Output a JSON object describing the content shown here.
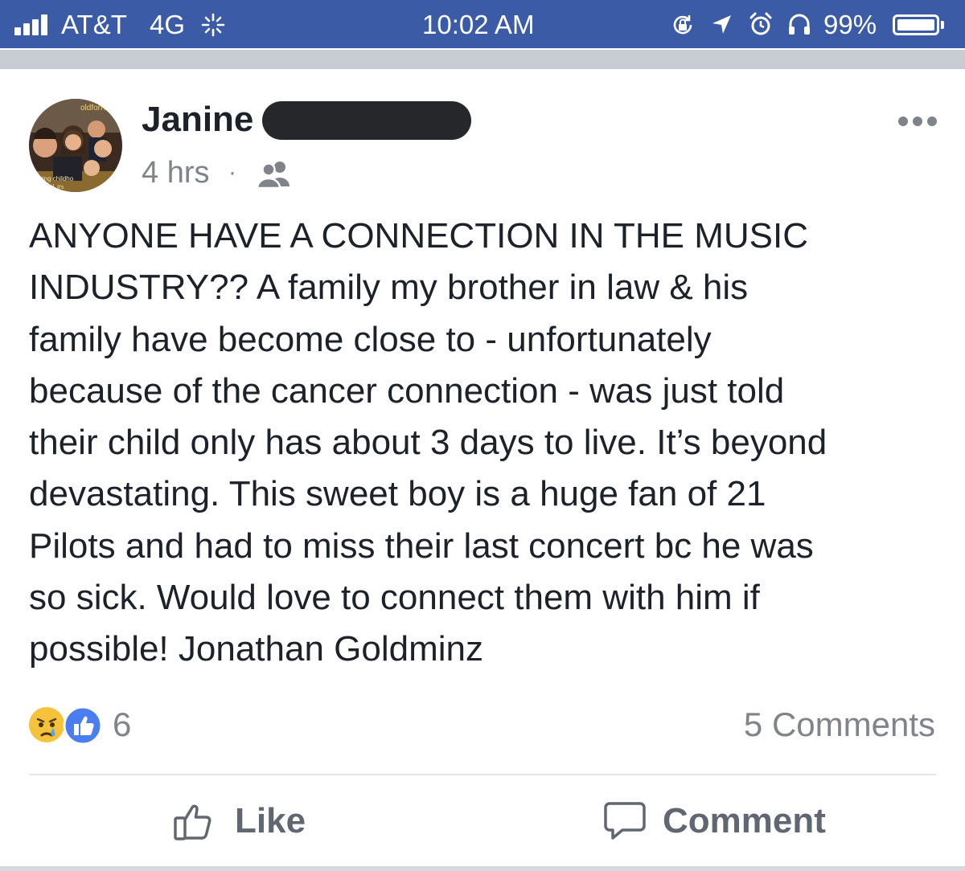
{
  "status_bar": {
    "carrier": "AT&T",
    "network": "4G",
    "time": "10:02 AM",
    "battery": "99%",
    "background_color": "#3b5ba6",
    "icons": [
      "signal-bars-icon",
      "activity-spinner-icon",
      "orientation-lock-icon",
      "location-arrow-icon",
      "alarm-icon",
      "headphones-icon",
      "battery-icon"
    ]
  },
  "post": {
    "author": "Janine",
    "author_surname_redacted": true,
    "timestamp": "4 hrs",
    "separator": "·",
    "audience_icon": "friends-icon",
    "more_icon": "more-options-icon",
    "body": "ANYONE HAVE A CONNECTION IN THE MUSIC\nINDUSTRY?? A family my brother in law & his\nfamily have become close to - unfortunately\nbecause of the cancer connection - was just told\ntheir child only has about 3 days to live. It’s beyond\ndevastating. This sweet boy is a huge fan of 21\nPilots and had to miss their last concert bc he was\nso sick. Would love to connect them with him if\npossible! Jonathan Goldminz"
  },
  "engagement": {
    "reaction_icons": [
      "sad-reaction-icon",
      "like-reaction-icon"
    ],
    "reaction_count": "6",
    "comments": "5 Comments"
  },
  "actions": {
    "like_label": "Like",
    "comment_label": "Comment"
  },
  "colors": {
    "text": "#1d2129",
    "secondary_text": "#7f838a",
    "action_text": "#616770",
    "like_blue": "#4a7ef0",
    "sad_yellow": "#f5c33b"
  }
}
